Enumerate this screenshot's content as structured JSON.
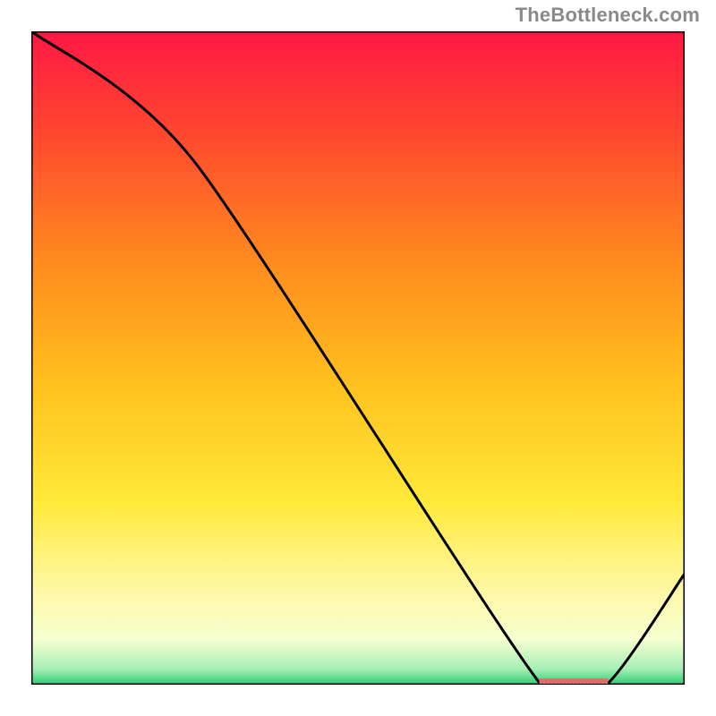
{
  "watermark": "TheBottleneck.com",
  "chart_data": {
    "type": "line",
    "title": "",
    "xlabel": "",
    "ylabel": "",
    "xlim": [
      0,
      100
    ],
    "ylim": [
      0,
      100
    ],
    "grid": false,
    "x": [
      0,
      25,
      78,
      88,
      100
    ],
    "values": [
      100,
      80,
      0,
      0,
      17
    ],
    "optimal_marker": {
      "x_start": 78,
      "x_end": 88,
      "y": 0
    },
    "background_gradient": {
      "stops": [
        {
          "offset": 0.0,
          "color": "#ff1744"
        },
        {
          "offset": 0.15,
          "color": "#ff4530"
        },
        {
          "offset": 0.35,
          "color": "#ff8a1e"
        },
        {
          "offset": 0.55,
          "color": "#ffc31e"
        },
        {
          "offset": 0.72,
          "color": "#ffe93a"
        },
        {
          "offset": 0.86,
          "color": "#fff8a8"
        },
        {
          "offset": 0.93,
          "color": "#f6ffd0"
        },
        {
          "offset": 0.975,
          "color": "#a9f0b8"
        },
        {
          "offset": 1.0,
          "color": "#2ecc71"
        }
      ]
    }
  }
}
